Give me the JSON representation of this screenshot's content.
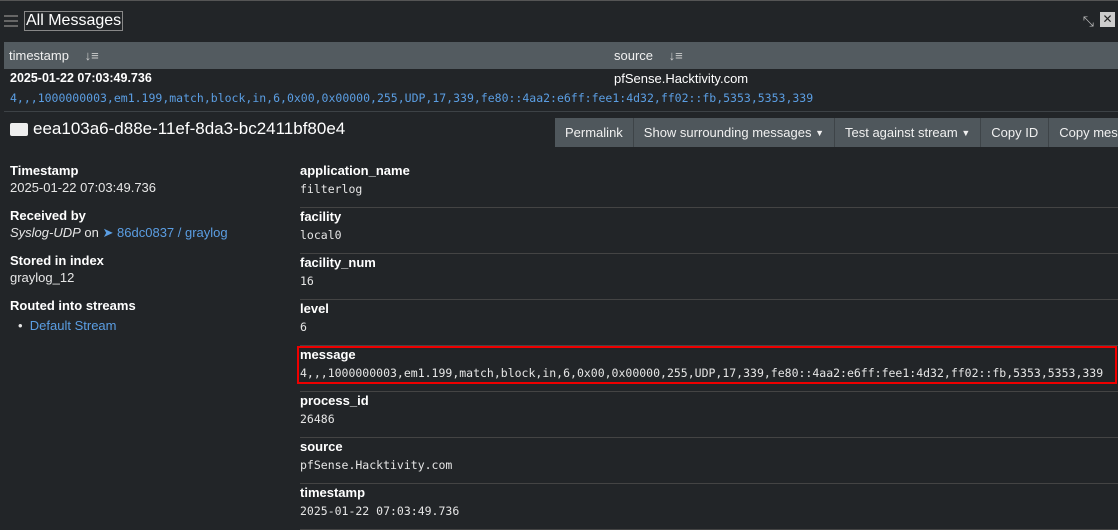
{
  "header": {
    "title": "All Messages",
    "icons": [
      "hamburger-icon",
      "compress-icon",
      "expand-icon"
    ]
  },
  "table": {
    "columns": [
      "timestamp",
      "source"
    ],
    "row": {
      "timestamp": "2025-01-22 07:03:49.736",
      "source": "pfSense.Hacktivity.com",
      "message": "4,,,1000000003,em1.199,match,block,in,6,0x00,0x00000,255,UDP,17,339,fe80::4aa2:e6ff:fee1:4d32,ff02::fb,5353,5353,339"
    }
  },
  "detail": {
    "id": "eea103a6-d88e-11ef-8da3-bc2411bf80e4",
    "buttons": [
      "Permalink",
      "Show surrounding messages",
      "Test against stream",
      "Copy ID",
      "Copy mess"
    ],
    "meta": {
      "timestamp_label": "Timestamp",
      "timestamp": "2025-01-22 07:03:49.736",
      "received_label": "Received by",
      "input": "Syslog-UDP",
      "on": "on",
      "node": "86dc0837 / graylog",
      "index_label": "Stored in index",
      "index": "graylog_12",
      "streams_label": "Routed into streams",
      "streams": [
        "Default Stream"
      ]
    },
    "fields": [
      {
        "name": "application_name",
        "value": "filterlog"
      },
      {
        "name": "facility",
        "value": "local0"
      },
      {
        "name": "facility_num",
        "value": "16"
      },
      {
        "name": "level",
        "value": "6"
      },
      {
        "name": "message",
        "value": "4,,,1000000003,em1.199,match,block,in,6,0x00,0x00000,255,UDP,17,339,fe80::4aa2:e6ff:fee1:4d32,ff02::fb,5353,5353,339"
      },
      {
        "name": "process_id",
        "value": "26486"
      },
      {
        "name": "source",
        "value": "pfSense.Hacktivity.com"
      },
      {
        "name": "timestamp",
        "value": "2025-01-22 07:03:49.736"
      }
    ]
  },
  "colors": {
    "link": "#5b9ee3",
    "highlight": "#e00000",
    "header_bg": "#535b60"
  }
}
